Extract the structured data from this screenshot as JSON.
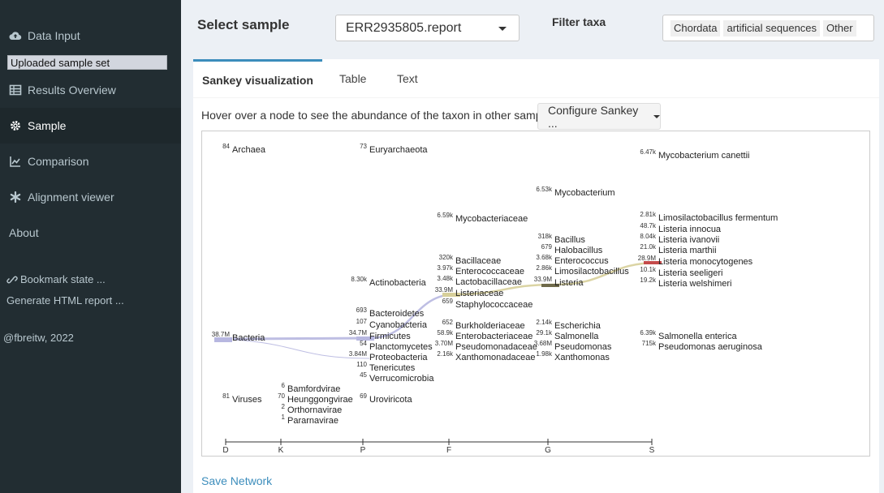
{
  "sidebar": {
    "items": [
      {
        "label": "Data Input",
        "icon": "cloud-upload-icon"
      },
      {
        "label": "Results Overview",
        "icon": "table-icon"
      },
      {
        "label": "Sample",
        "icon": "gear-icon"
      },
      {
        "label": "Comparison",
        "icon": "line-chart-icon"
      },
      {
        "label": "Alignment viewer",
        "icon": "asterisk-icon"
      },
      {
        "label": "About",
        "icon": ""
      }
    ],
    "sample_set": "Uploaded sample set",
    "bookmark": "Bookmark state ...",
    "generate": "Generate HTML report ...",
    "credit": "@fbreitw, 2022"
  },
  "header": {
    "title": "Select sample",
    "selected_sample": "ERR2935805.report",
    "filter_label": "Filter taxa",
    "filter_chips": [
      "Chordata",
      "artificial sequences",
      "Other"
    ]
  },
  "tabs": [
    "Sankey visualization",
    "Table",
    "Text"
  ],
  "hint": "Hover over a node to see the abundance of the taxon in other samples.",
  "configure_label": "Configure Sankey ...",
  "save_label": "Save Network",
  "colors": {
    "accent": "#3c8dbc",
    "bacteria_link": "#b7b7e0",
    "listeria_link": "#d7cf9a",
    "listeria_node": "#c44a4a"
  },
  "sankey": {
    "axis_ticks": [
      "D",
      "K",
      "P",
      "F",
      "G",
      "S"
    ],
    "nodes": [
      {
        "count": "84",
        "name": "Archaea"
      },
      {
        "count": "38.7M",
        "name": "Bacteria"
      },
      {
        "count": "81",
        "name": "Viruses"
      },
      {
        "count": "6",
        "name": "Bamfordvirae"
      },
      {
        "count": "70",
        "name": "Heunggongvirae"
      },
      {
        "count": "2",
        "name": "Orthornavirae"
      },
      {
        "count": "1",
        "name": "Pararnavirae"
      },
      {
        "count": "73",
        "name": "Euryarchaeota"
      },
      {
        "count": "8.30k",
        "name": "Actinobacteria"
      },
      {
        "count": "693",
        "name": "Bacteroidetes"
      },
      {
        "count": "107",
        "name": "Cyanobacteria"
      },
      {
        "count": "34.7M",
        "name": "Firmicutes"
      },
      {
        "count": "54",
        "name": "Planctomycetes"
      },
      {
        "count": "3.84M",
        "name": "Proteobacteria"
      },
      {
        "count": "110",
        "name": "Tenericutes"
      },
      {
        "count": "45",
        "name": "Verrucomicrobia"
      },
      {
        "count": "69",
        "name": "Uroviricota"
      },
      {
        "count": "6.59k",
        "name": "Mycobacteriaceae"
      },
      {
        "count": "320k",
        "name": "Bacillaceae"
      },
      {
        "count": "3.97k",
        "name": "Enterococcaceae"
      },
      {
        "count": "3.48k",
        "name": "Lactobacillaceae"
      },
      {
        "count": "33.9M",
        "name": "Listeriaceae"
      },
      {
        "count": "659",
        "name": "Staphylococcaceae"
      },
      {
        "count": "652",
        "name": "Burkholderiaceae"
      },
      {
        "count": "58.9k",
        "name": "Enterobacteriaceae"
      },
      {
        "count": "3.70M",
        "name": "Pseudomonadaceae"
      },
      {
        "count": "2.16k",
        "name": "Xanthomonadaceae"
      },
      {
        "count": "6.53k",
        "name": "Mycobacterium"
      },
      {
        "count": "318k",
        "name": "Bacillus"
      },
      {
        "count": "679",
        "name": "Halobacillus"
      },
      {
        "count": "3.68k",
        "name": "Enterococcus"
      },
      {
        "count": "2.86k",
        "name": "Limosilactobacillus"
      },
      {
        "count": "33.9M",
        "name": "Listeria"
      },
      {
        "count": "2.14k",
        "name": "Escherichia"
      },
      {
        "count": "29.1k",
        "name": "Salmonella"
      },
      {
        "count": "3.68M",
        "name": "Pseudomonas"
      },
      {
        "count": "1.98k",
        "name": "Xanthomonas"
      },
      {
        "count": "6.47k",
        "name": "Mycobacterium canettii"
      },
      {
        "count": "2.81k",
        "name": "Limosilactobacillus fermentum"
      },
      {
        "count": "48.7k",
        "name": "Listeria innocua"
      },
      {
        "count": "8.04k",
        "name": "Listeria ivanovii"
      },
      {
        "count": "21.0k",
        "name": "Listeria marthii"
      },
      {
        "count": "28.9M",
        "name": "Listeria monocytogenes"
      },
      {
        "count": "10.1k",
        "name": "Listeria seeligeri"
      },
      {
        "count": "19.2k",
        "name": "Listeria welshimeri"
      },
      {
        "count": "6.39k",
        "name": "Salmonella enterica"
      },
      {
        "count": "715k",
        "name": "Pseudomonas aeruginosa"
      }
    ]
  }
}
